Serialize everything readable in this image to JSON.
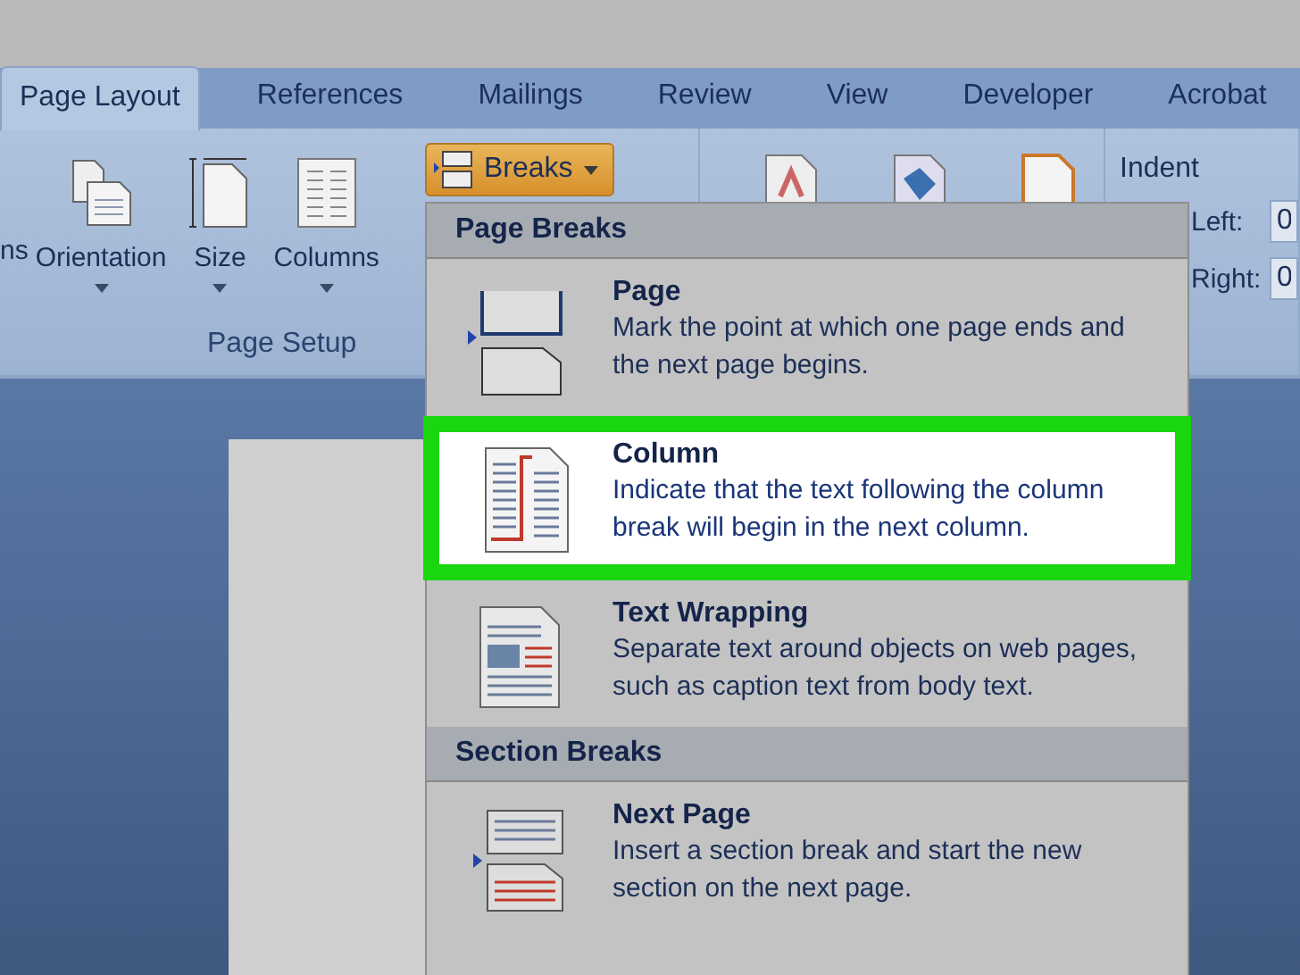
{
  "tabs": [
    {
      "label": "Page Layout",
      "selected": true
    },
    {
      "label": "References",
      "selected": false
    },
    {
      "label": "Mailings",
      "selected": false
    },
    {
      "label": "Review",
      "selected": false
    },
    {
      "label": "View",
      "selected": false
    },
    {
      "label": "Developer",
      "selected": false
    },
    {
      "label": "Acrobat",
      "selected": false
    }
  ],
  "ribbon": {
    "page_setup": {
      "buttons": [
        {
          "label": "ns",
          "kind": "cut"
        },
        {
          "label": "Orientation",
          "kind": "orientation"
        },
        {
          "label": "Size",
          "kind": "size"
        },
        {
          "label": "Columns",
          "kind": "columns"
        }
      ],
      "breaks_button": {
        "label": "Breaks",
        "pressed": true
      },
      "group_label": "Page Setup"
    },
    "indent": {
      "label": "Indent",
      "fields": [
        {
          "label": "Left:",
          "value": "0"
        },
        {
          "label": "Right:",
          "value": "0"
        }
      ]
    }
  },
  "breaks_menu": {
    "sections": [
      {
        "heading": "Page Breaks",
        "items": [
          {
            "title": "Page",
            "description": "Mark the point at which one page ends and the next page begins.",
            "kind": "page",
            "selected": false
          },
          {
            "title": "Column",
            "description": "Indicate that the text following the column break will begin in the next column.",
            "kind": "column",
            "selected": true
          },
          {
            "title": "Text Wrapping",
            "description": "Separate text around objects on web pages, such as caption text from body text.",
            "kind": "text_wrapping",
            "selected": false
          }
        ]
      },
      {
        "heading": "Section Breaks",
        "items": [
          {
            "title": "Next Page",
            "description": "Insert a section break and start the new section on the next page.",
            "kind": "next_page",
            "selected": false
          }
        ]
      }
    ]
  }
}
